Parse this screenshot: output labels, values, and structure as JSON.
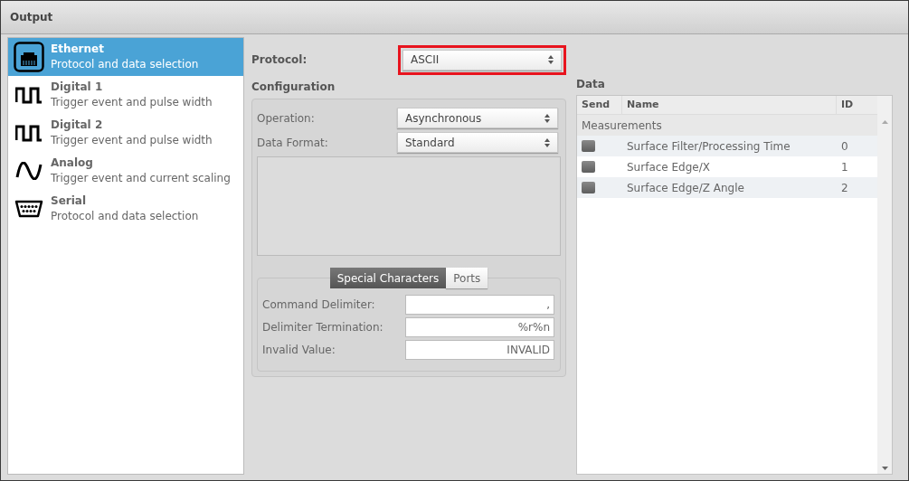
{
  "window": {
    "title": "Output"
  },
  "sidebar": {
    "items": [
      {
        "kind": "ethernet",
        "title": "Ethernet",
        "subtitle": "Protocol and data selection",
        "selected": true
      },
      {
        "kind": "digital",
        "title": "Digital 1",
        "subtitle": "Trigger event and pulse width",
        "selected": false
      },
      {
        "kind": "digital",
        "title": "Digital 2",
        "subtitle": "Trigger event and pulse width",
        "selected": false
      },
      {
        "kind": "analog",
        "title": "Analog",
        "subtitle": "Trigger event and current scaling",
        "selected": false
      },
      {
        "kind": "serial",
        "title": "Serial",
        "subtitle": "Protocol and data selection",
        "selected": false
      }
    ]
  },
  "protocol": {
    "label": "Protocol:",
    "value": "ASCII",
    "highlighted": true
  },
  "configuration": {
    "title": "Configuration",
    "selects": [
      {
        "label": "Operation:",
        "value": "Asynchronous"
      },
      {
        "label": "Data Format:",
        "value": "Standard"
      }
    ],
    "tabs": [
      {
        "label": "Special Characters",
        "selected": true
      },
      {
        "label": "Ports",
        "selected": false
      }
    ],
    "fields": [
      {
        "label": "Command Delimiter:",
        "value": ","
      },
      {
        "label": "Delimiter Termination:",
        "value": "%r%n"
      },
      {
        "label": "Invalid Value:",
        "value": "INVALID"
      }
    ]
  },
  "data": {
    "title": "Data",
    "columns": [
      "Send",
      "Name",
      "ID"
    ],
    "group": "Measurements",
    "rows": [
      {
        "checked": false,
        "name": "Surface Filter/Processing Time",
        "id": "0"
      },
      {
        "checked": false,
        "name": "Surface Edge/X",
        "id": "1"
      },
      {
        "checked": false,
        "name": "Surface Edge/Z Angle",
        "id": "2"
      }
    ]
  }
}
